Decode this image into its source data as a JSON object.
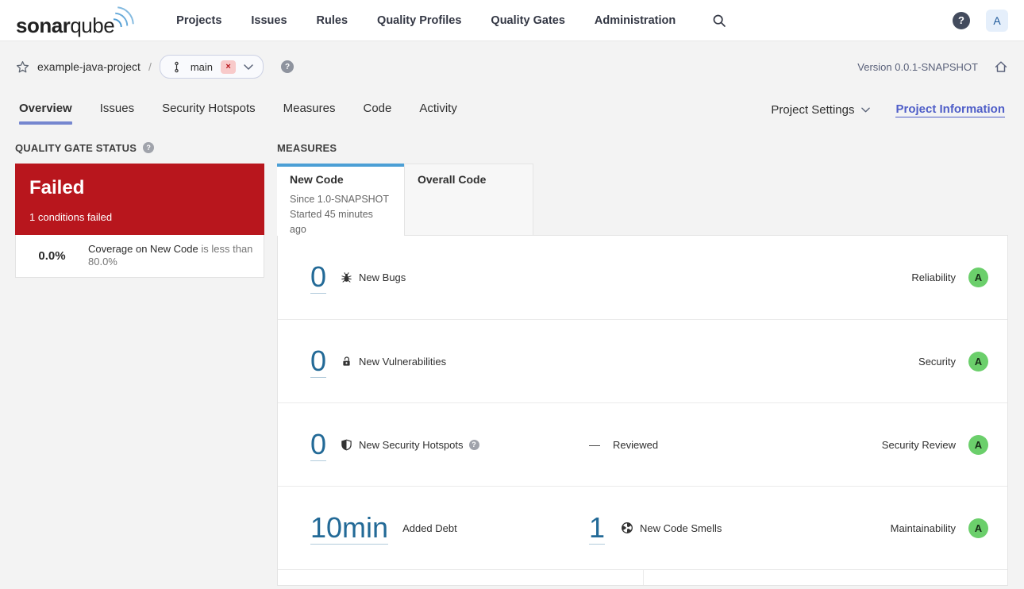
{
  "nav": {
    "logo_bold": "sonar",
    "logo_light": "qube",
    "items": [
      "Projects",
      "Issues",
      "Rules",
      "Quality Profiles",
      "Quality Gates",
      "Administration"
    ],
    "help_label": "?",
    "avatar_label": "A"
  },
  "breadcrumb": {
    "project": "example-java-project",
    "separator": "/",
    "branch_name": "main",
    "branch_close": "×",
    "help_label": "?",
    "version": "Version 0.0.1-SNAPSHOT"
  },
  "tabs": {
    "items": [
      "Overview",
      "Issues",
      "Security Hotspots",
      "Measures",
      "Code",
      "Activity"
    ],
    "active": "Overview",
    "project_settings": "Project Settings",
    "project_information": "Project Information"
  },
  "quality_gate": {
    "title": "QUALITY GATE STATUS",
    "help_label": "?",
    "status": "Failed",
    "conditions_summary": "1 conditions failed",
    "condition": {
      "value": "0.0%",
      "metric": "Coverage on New Code",
      "comparison": "is less than 80.0%"
    }
  },
  "measures": {
    "title": "MEASURES",
    "tabs": {
      "new_code": {
        "label": "New Code",
        "line1": "Since 1.0-SNAPSHOT",
        "line2": "Started 45 minutes ago"
      },
      "overall_code": {
        "label": "Overall Code"
      }
    },
    "rows": [
      {
        "value": "0",
        "label": "New Bugs",
        "icon": "bug-icon",
        "domain": "Reliability",
        "rating": "A"
      },
      {
        "value": "0",
        "label": "New Vulnerabilities",
        "icon": "lock-icon",
        "domain": "Security",
        "rating": "A"
      },
      {
        "value": "0",
        "label": "New Security Hotspots",
        "icon": "shield-icon",
        "help_label": "?",
        "secondary_value": "—",
        "secondary_label": "Reviewed",
        "domain": "Security Review",
        "rating": "A"
      },
      {
        "value": "10min",
        "label": "Added Debt",
        "secondary_value": "1",
        "secondary_label": "New Code Smells",
        "secondary_icon": "code-smell-icon",
        "domain": "Maintainability",
        "rating": "A"
      }
    ]
  },
  "colors": {
    "failed_red": "#b8161d",
    "rating_green": "#6bcf6b",
    "link_blue": "#236a97",
    "tab_blue": "#4b9fd5",
    "accent_purple": "#7586cf",
    "page_bg": "#f3f3f3"
  }
}
